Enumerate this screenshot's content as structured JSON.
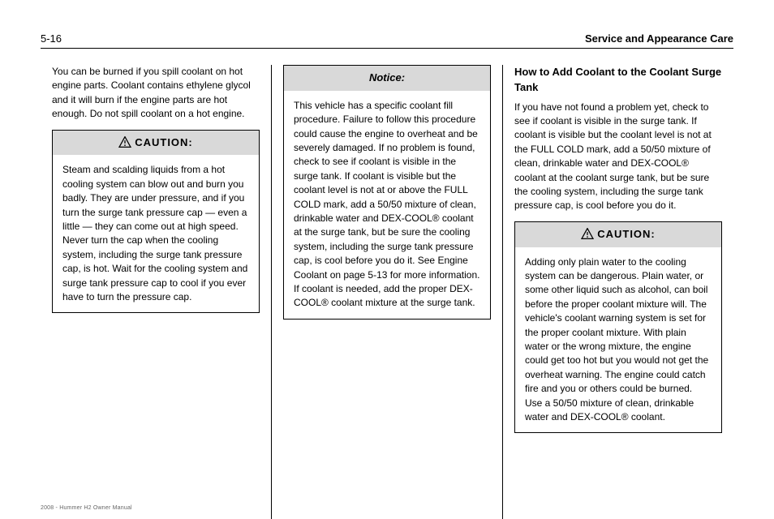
{
  "header": {
    "page_number": "5-16",
    "section_title": "Service and Appearance Care"
  },
  "col1": {
    "intro": "You can be burned if you spill coolant on hot engine parts. Coolant contains ethylene glycol and it will burn if the engine parts are hot enough. Do not spill coolant on a hot engine.",
    "caution_label": "CAUTION:",
    "caution_body": "Steam and scalding liquids from a hot cooling system can blow out and burn you badly. They are under pressure, and if you turn the surge tank pressure cap — even a little — they can come out at high speed. Never turn the cap when the cooling system, including the surge tank pressure cap, is hot. Wait for the cooling system and surge tank pressure cap to cool if you ever have to turn the pressure cap."
  },
  "col2": {
    "notice_label": "Notice:",
    "notice_body": "This vehicle has a specific coolant fill procedure. Failure to follow this procedure could cause the engine to overheat and be severely damaged.\n\nIf no problem is found, check to see if coolant is visible in the surge tank. If coolant is visible but the coolant level is not at or above the FULL COLD mark, add a 50/50 mixture of clean, drinkable water and DEX-COOL® coolant at the surge tank, but be sure the cooling system, including the surge tank pressure cap, is cool before you do it. See Engine Coolant on page 5-13 for more information.\n\nIf coolant is needed, add the proper DEX-COOL® coolant mixture at the surge tank."
  },
  "col3": {
    "heading": "How to Add Coolant to the Coolant Surge Tank",
    "para1": "If you have not found a problem yet, check to see if coolant is visible in the surge tank. If coolant is visible but the coolant level is not at the FULL COLD mark, add a 50/50 mixture of clean, drinkable water and DEX-COOL® coolant at the coolant surge tank, but be sure the cooling system, including the surge tank pressure cap, is cool before you do it.",
    "caution_label": "CAUTION:",
    "caution_body": "Adding only plain water to the cooling system can be dangerous. Plain water, or some other liquid such as alcohol, can boil before the proper coolant mixture will. The vehicle's coolant warning system is set for the proper coolant mixture. With plain water or the wrong mixture, the engine could get too hot but you would not get the overheat warning. The engine could catch fire and you or others could be burned. Use a 50/50 mixture of clean, drinkable water and DEX-COOL® coolant."
  },
  "footline": "2008 - Hummer H2 Owner Manual"
}
